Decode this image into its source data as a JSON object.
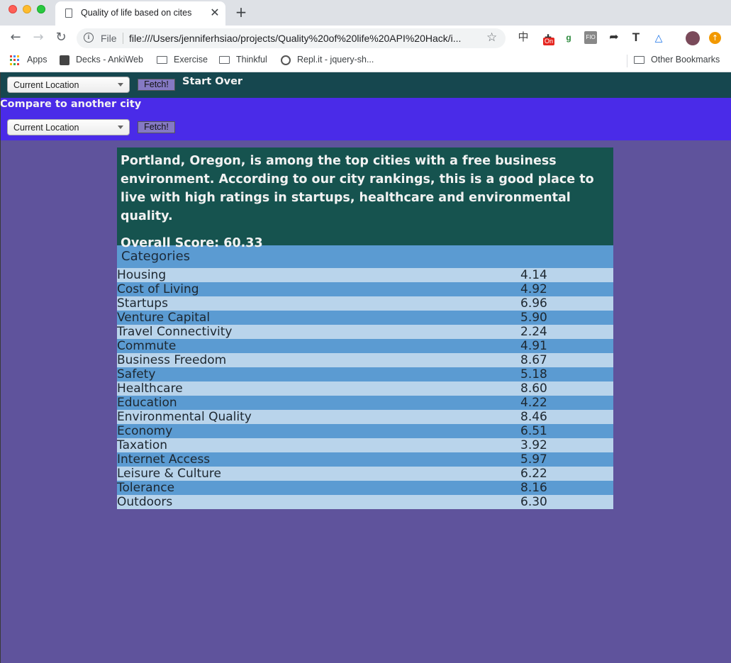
{
  "browser": {
    "tab_title": "Quality of life based on cites",
    "url_scheme": "File",
    "url": "file:///Users/jenniferhsiao/projects/Quality%20of%20life%20API%20Hack/i...",
    "bookmarks": [
      "Apps",
      "Decks - AnkiWeb",
      "Exercise",
      "Thinkful",
      "Repl.it - jquery-sh..."
    ],
    "other_bookmarks": "Other Bookmarks"
  },
  "topbar": {
    "select_value": "Current Location",
    "fetch_label": "Fetch!",
    "start_over_label": "Start Over"
  },
  "compare": {
    "title": "Compare to another city",
    "select_value": "Current Location",
    "fetch_label": "Fetch!"
  },
  "summary": {
    "text": "Portland, Oregon, is among the top cities with a free business environment. According to our city rankings, this is a good place to live with high ratings in startups, healthcare and environmental quality.",
    "overall_score": "Overall Score: 60.33"
  },
  "categories": {
    "header": "Categories",
    "rows": [
      {
        "name": "Housing",
        "score": "4.14"
      },
      {
        "name": "Cost of Living",
        "score": "4.92"
      },
      {
        "name": "Startups",
        "score": "6.96"
      },
      {
        "name": "Venture Capital",
        "score": "5.90"
      },
      {
        "name": "Travel Connectivity",
        "score": "2.24"
      },
      {
        "name": "Commute",
        "score": "4.91"
      },
      {
        "name": "Business Freedom",
        "score": "8.67"
      },
      {
        "name": "Safety",
        "score": "5.18"
      },
      {
        "name": "Healthcare",
        "score": "8.60"
      },
      {
        "name": "Education",
        "score": "4.22"
      },
      {
        "name": "Environmental Quality",
        "score": "8.46"
      },
      {
        "name": "Economy",
        "score": "6.51"
      },
      {
        "name": "Taxation",
        "score": "3.92"
      },
      {
        "name": "Internet Access",
        "score": "5.97"
      },
      {
        "name": "Leisure & Culture",
        "score": "6.22"
      },
      {
        "name": "Tolerance",
        "score": "8.16"
      },
      {
        "name": "Outdoors",
        "score": "6.30"
      }
    ]
  },
  "colors": {
    "page_bg": "#5f539c",
    "topbar_bg": "#16474f",
    "compare_bg": "#4a2be8",
    "summary_bg": "#16534f",
    "row_light": "#b9d4eb",
    "row_dark": "#5b9bd2"
  }
}
